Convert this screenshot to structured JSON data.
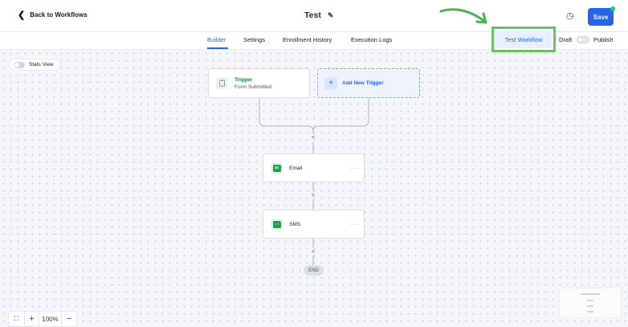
{
  "header": {
    "back_label": "Back to Workflows",
    "workflow_title": "Test",
    "save_label": "Save"
  },
  "tabs": [
    {
      "label": "Builder",
      "active": true
    },
    {
      "label": "Settings",
      "active": false
    },
    {
      "label": "Enrollment History",
      "active": false
    },
    {
      "label": "Execution Logs",
      "active": false
    }
  ],
  "actions_bar": {
    "test_workflow_label": "Test Workflow",
    "draft_label": "Draft",
    "publish_label": "Publish"
  },
  "canvas": {
    "stats_view_label": "Stats View",
    "trigger": {
      "title": "Trigger",
      "subtitle": "Form Submitted"
    },
    "add_trigger_label": "Add New Trigger",
    "steps": [
      {
        "label": "Email",
        "icon": "envelope-icon"
      },
      {
        "label": "SMS",
        "icon": "chat-bubble-icon"
      }
    ],
    "end_label": "END",
    "zoom_level": "100%"
  },
  "colors": {
    "accent": "#2563eb",
    "highlight_box": "#6abf69",
    "trigger_green": "#16a34a"
  }
}
